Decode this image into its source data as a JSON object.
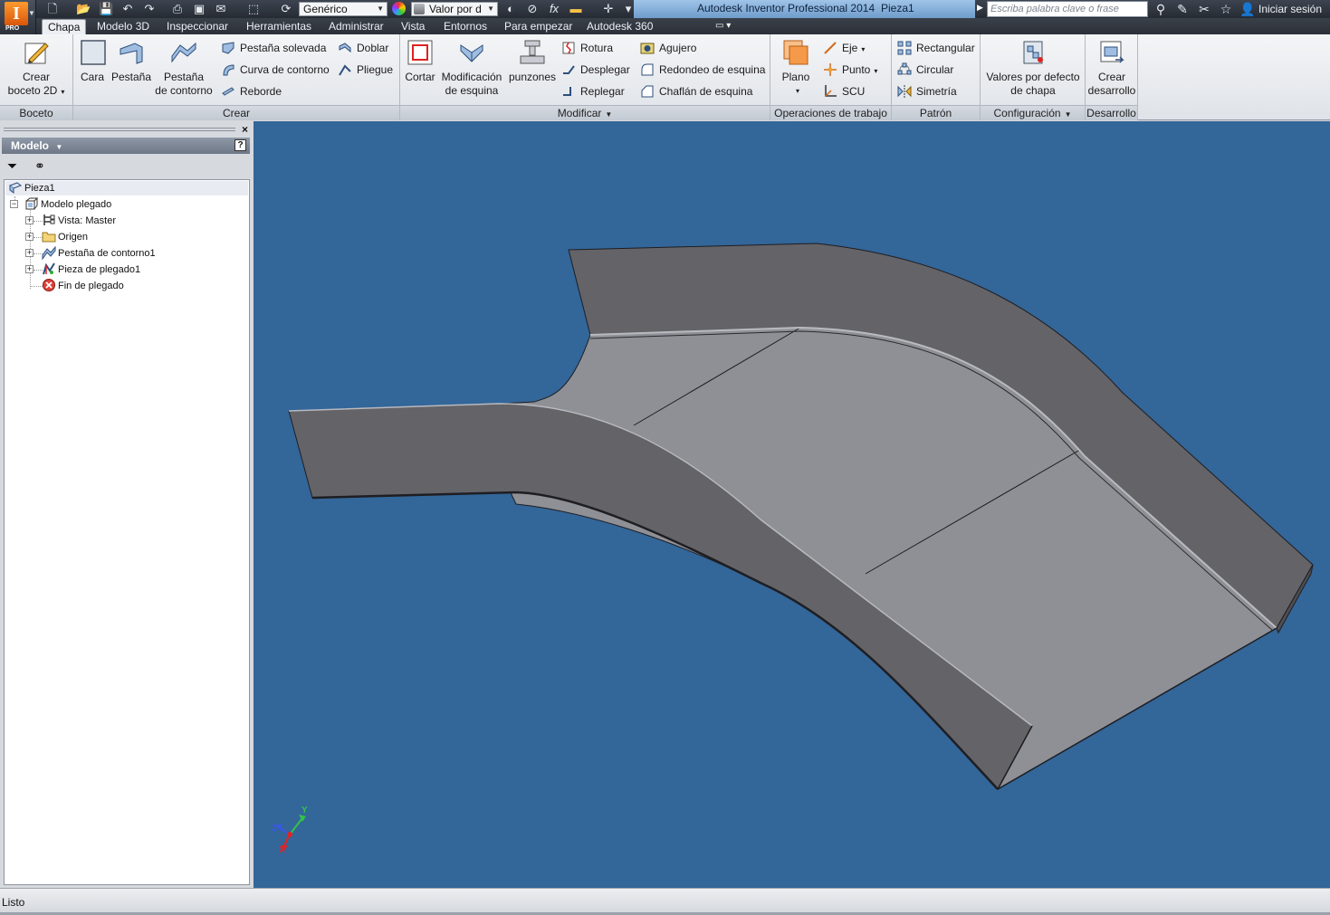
{
  "app": {
    "title": "Autodesk Inventor Professional 2014",
    "document": "Pieza1",
    "logo_letter": "I",
    "logo_badge": "PRO"
  },
  "quick_access": {
    "material": "Genérico",
    "appearance": "Valor por d",
    "fx": "fx"
  },
  "help": {
    "search_placeholder": "Escriba palabra clave o frase",
    "signin": "Iniciar sesión"
  },
  "tabs": [
    {
      "label": "Chapa",
      "active": true
    },
    {
      "label": "Modelo 3D"
    },
    {
      "label": "Inspeccionar"
    },
    {
      "label": "Herramientas"
    },
    {
      "label": "Administrar"
    },
    {
      "label": "Vista"
    },
    {
      "label": "Entornos"
    },
    {
      "label": "Para empezar"
    },
    {
      "label": "Autodesk 360"
    }
  ],
  "ribbon": {
    "boceto": {
      "title": "Boceto",
      "crear_boceto": "Crear",
      "crear_boceto_2": "boceto 2D"
    },
    "crear": {
      "title": "Crear",
      "cara": "Cara",
      "pestana": "Pestaña",
      "pestana_contorno": "Pestaña",
      "pestana_contorno_2": "de contorno",
      "pestana_solevada": "Pestaña solevada",
      "curva_contorno": "Curva de contorno",
      "reborde": "Reborde",
      "doblar": "Doblar",
      "pliegue": "Pliegue"
    },
    "modificar": {
      "title": "Modificar",
      "cortar": "Cortar",
      "mod_esquina": "Modificación",
      "mod_esquina_2": "de esquina",
      "punzones": "punzones",
      "rotura": "Rotura",
      "desplegar": "Desplegar",
      "replegar": "Replegar",
      "agujero": "Agujero",
      "redondeo_esquina": "Redondeo de esquina",
      "chaflan_esquina": "Chaflán de esquina"
    },
    "operaciones": {
      "title": "Operaciones de trabajo",
      "plano": "Plano",
      "eje": "Eje",
      "punto": "Punto",
      "scu": "SCU"
    },
    "patron": {
      "title": "Patrón",
      "rectangular": "Rectangular",
      "circular": "Circular",
      "simetria": "Simetría"
    },
    "configuracion": {
      "title": "Configuración",
      "valores": "Valores por defecto",
      "valores_2": "de chapa"
    },
    "desarrollo": {
      "title": "Desarrollo",
      "crear_desarrollo": "Crear",
      "crear_desarrollo_2": "desarrollo"
    }
  },
  "browser": {
    "title": "Modelo",
    "help": "?",
    "close": "×",
    "tree": [
      {
        "label": "Pieza1"
      },
      {
        "label": "Modelo plegado"
      },
      {
        "label": "Vista: Master"
      },
      {
        "label": "Origen"
      },
      {
        "label": "Pestaña de contorno1"
      },
      {
        "label": "Pieza de plegado1"
      },
      {
        "label": "Fin de plegado"
      }
    ]
  },
  "viewcube": {
    "x": "X",
    "y": "Y",
    "z": "Z"
  },
  "status": {
    "text": "Listo"
  },
  "colors": {
    "viewport_bg": "#336699",
    "flange_dark": "#636368",
    "base_light": "#8f9096",
    "edge": "#1e1e22"
  }
}
